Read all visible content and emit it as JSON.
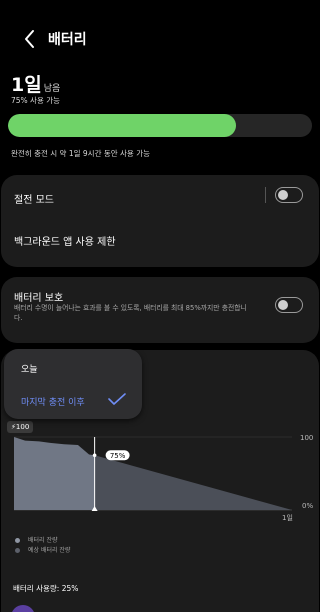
{
  "header": {
    "title": "배터리"
  },
  "summary": {
    "remaining_value": "1일",
    "remaining_unit": "남음",
    "percent_text": "75% 사용 가능",
    "level_fraction": 0.75,
    "full_charge_text": "완전히 충전 시 약 1일 9시간 동안 사용 가능",
    "bar_color": "#6fd368"
  },
  "settings": {
    "power_saving": {
      "label": "절전 모드",
      "on": false
    },
    "background_limit": {
      "label": "백그라운드 앱 사용 제한"
    },
    "battery_protect": {
      "label": "배터리 보호",
      "description": "배터리 수명이 늘어나는 효과를 볼 수 있도록, 배터리를 최대 85%까지만 충전합니다.",
      "on": false
    }
  },
  "period_menu": {
    "options": [
      "오늘",
      "마지막 충전 이후"
    ],
    "selected": "마지막 충전 이후",
    "accent": "#6f8df5"
  },
  "chart_data": {
    "type": "area",
    "start_label": "100",
    "marker_label": "75%",
    "y_labels": [
      "100",
      "0%"
    ],
    "x_label": "1일",
    "ylim": [
      0,
      100
    ],
    "series": [
      {
        "name": "배터리 잔량",
        "x": [
          0,
          0.04,
          0.09,
          0.13,
          0.18,
          0.23,
          0.27,
          0.29
        ],
        "y": [
          100,
          95,
          94,
          92,
          90,
          89,
          76,
          75
        ]
      },
      {
        "name": "예상 배터리 잔량",
        "x": [
          0.29,
          1.0
        ],
        "y": [
          75,
          0
        ]
      }
    ],
    "colors": {
      "actual": "#707785",
      "projected": "#4b4f58"
    }
  },
  "usage": {
    "text": "배터리 사용량: 25%"
  }
}
